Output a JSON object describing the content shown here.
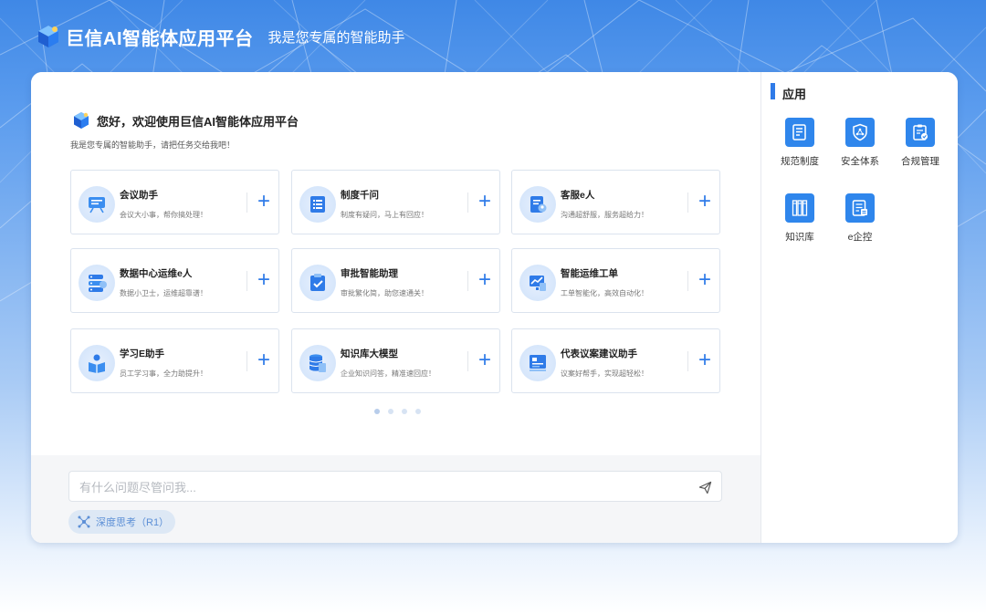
{
  "header": {
    "brand": "巨信AI智能体应用平台",
    "tagline": "我是您专属的智能助手"
  },
  "welcome": {
    "title": "您好，欢迎使用巨信AI智能体应用平台",
    "subtitle": "我是您专属的智能助手，请把任务交给我吧！"
  },
  "cards": [
    {
      "title": "会议助手",
      "desc": "会议大小事，帮你搞处理！",
      "icon": "meeting-icon"
    },
    {
      "title": "制度千问",
      "desc": "制度有疑问，马上有回应！",
      "icon": "policy-qa-icon"
    },
    {
      "title": "客服e人",
      "desc": "沟通超舒服，服务超给力！",
      "icon": "customer-service-icon"
    },
    {
      "title": "数据中心运维e人",
      "desc": "数据小卫士，运维超靠谱！",
      "icon": "server-icon"
    },
    {
      "title": "审批智能助理",
      "desc": "审批繁化简，助您速通关！",
      "icon": "approval-icon"
    },
    {
      "title": "智能运维工单",
      "desc": "工单智能化，高效自动化！",
      "icon": "work-order-icon"
    },
    {
      "title": "学习E助手",
      "desc": "员工学习事，全力助提升！",
      "icon": "study-icon"
    },
    {
      "title": "知识库大模型",
      "desc": "企业知识问答，精准速回应！",
      "icon": "database-icon"
    },
    {
      "title": "代表议案建议助手",
      "desc": "议案好帮手，实现超轻松！",
      "icon": "proposal-icon"
    }
  ],
  "pagination": {
    "pages": 4,
    "current": 1
  },
  "input": {
    "placeholder": "有什么问题尽管问我..."
  },
  "deep_think": {
    "label": "深度思考（R1）"
  },
  "apps": {
    "title": "应用",
    "items": [
      {
        "label": "规范制度",
        "icon": "regulation-icon"
      },
      {
        "label": "安全体系",
        "icon": "security-shield-icon"
      },
      {
        "label": "合规管理",
        "icon": "compliance-clipboard-icon"
      },
      {
        "label": "知识库",
        "icon": "knowledge-books-icon"
      },
      {
        "label": "e企控",
        "icon": "enterprise-control-icon"
      }
    ]
  },
  "colors": {
    "accent": "#2f7be8",
    "header_bg": "#3f88e6"
  }
}
